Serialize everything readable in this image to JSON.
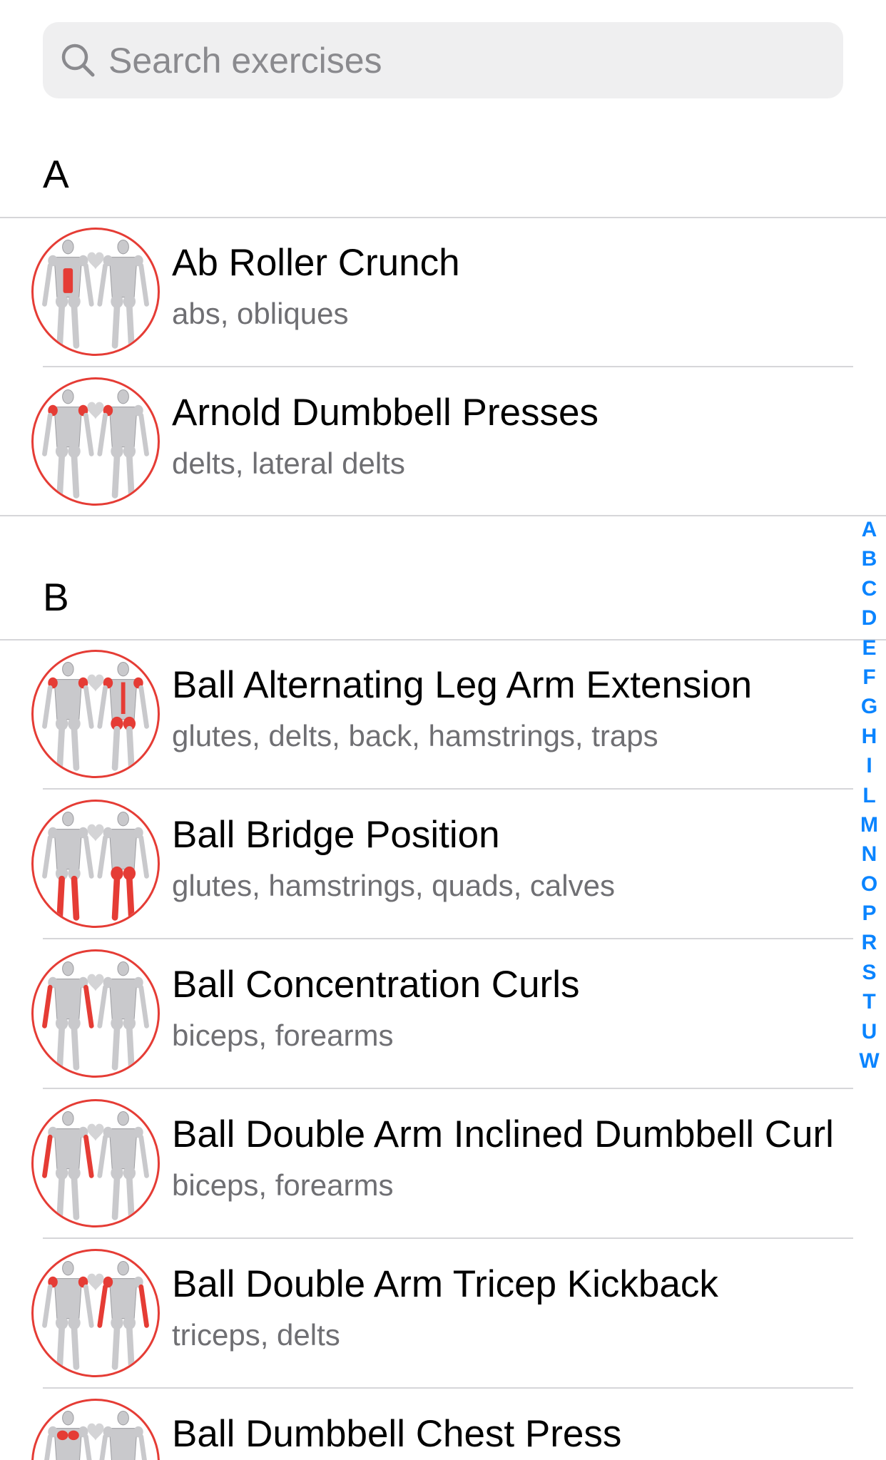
{
  "search": {
    "placeholder": "Search exercises",
    "value": ""
  },
  "sections": [
    {
      "letter": "A",
      "items": [
        {
          "title": "Ab Roller Crunch",
          "muscles": "abs, obliques",
          "highlight": "abs"
        },
        {
          "title": "Arnold Dumbbell Presses",
          "muscles": "delts, lateral delts",
          "highlight": "delts"
        }
      ]
    },
    {
      "letter": "B",
      "items": [
        {
          "title": "Ball Alternating Leg Arm Extension",
          "muscles": "glutes, delts, back, hamstrings, traps",
          "highlight": "glutes-back"
        },
        {
          "title": "Ball Bridge Position",
          "muscles": "glutes, hamstrings, quads, calves",
          "highlight": "legs"
        },
        {
          "title": "Ball Concentration Curls",
          "muscles": "biceps, forearms",
          "highlight": "biceps"
        },
        {
          "title": "Ball Double Arm Inclined Dumbbell Curl",
          "muscles": "biceps, forearms",
          "highlight": "biceps"
        },
        {
          "title": "Ball Double Arm Tricep Kickback",
          "muscles": "triceps, delts",
          "highlight": "triceps"
        },
        {
          "title": "Ball Dumbbell Chest Press",
          "muscles": "",
          "highlight": "chest"
        }
      ]
    }
  ],
  "index_letters": [
    "A",
    "B",
    "C",
    "D",
    "E",
    "F",
    "G",
    "H",
    "I",
    "L",
    "M",
    "N",
    "O",
    "P",
    "R",
    "S",
    "T",
    "U",
    "W"
  ],
  "colors": {
    "accent": "#0a84ff",
    "highlight": "#e53c35",
    "search_bg": "#efeff0",
    "separator": "#d6d6d9",
    "subtitle": "#6f6f73",
    "placeholder": "#8a8a8e"
  },
  "icons": {
    "search": "magnifier-icon",
    "favorite": "heart-icon",
    "thumbnail": "muscle-map-icon"
  }
}
